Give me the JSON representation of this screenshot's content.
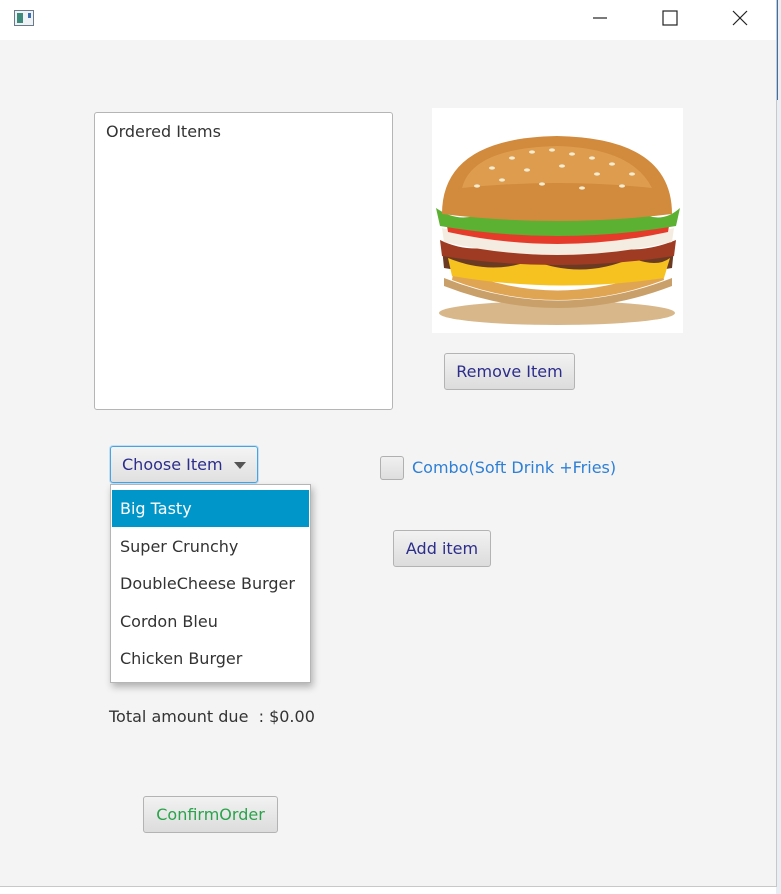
{
  "window": {
    "title_bar": {
      "minimize_icon": "minimize-icon",
      "maximize_icon": "maximize-icon",
      "close_icon": "close-icon"
    }
  },
  "ordered_items": {
    "header": "Ordered Items",
    "items": []
  },
  "image": {
    "subject": "burger"
  },
  "buttons": {
    "remove_item": "Remove Item",
    "add_item": "Add item",
    "confirm_order": "ConfirmOrder"
  },
  "item_select": {
    "label": "Choose Item",
    "options": [
      "Big Tasty",
      "Super Crunchy",
      "DoubleCheese Burger",
      "Cordon Bleu",
      "Chicken Burger"
    ],
    "highlighted": "Big Tasty"
  },
  "combo": {
    "label": "Combo(Soft Drink +Fries)",
    "checked": false
  },
  "total": {
    "label": "Total amount due  : ",
    "value": "$0.00"
  },
  "colors": {
    "selection": "#0096c9",
    "button_text": "#2d2d8c",
    "confirm_text": "#2aa34a",
    "combo_text": "#2e7fd6",
    "focus_border": "#4aa3e0"
  }
}
